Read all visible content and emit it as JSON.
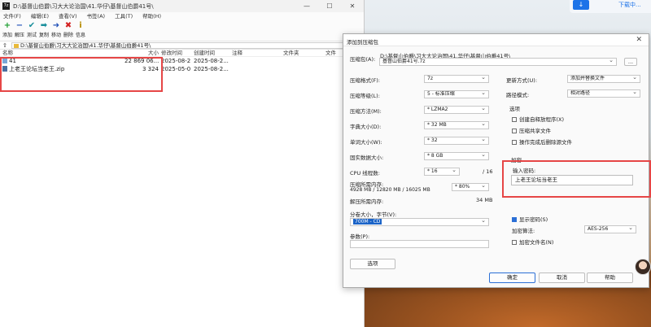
{
  "desktop": {
    "top_card_label": "下载中..."
  },
  "main_window": {
    "title": "D:\\基督山伯爵\\习大大论治国\\41.华仔\\基督山伯爵41号\\",
    "app_icon": "7z",
    "menu": [
      "文件(F)",
      "编辑(E)",
      "查看(V)",
      "书签(A)",
      "工具(T)",
      "帮助(H)"
    ],
    "toolbar": [
      {
        "label": "添加",
        "icon": "+",
        "color": "#1a9c2c"
      },
      {
        "label": "解压",
        "icon": "−",
        "color": "#2453b8"
      },
      {
        "label": "测试",
        "icon": "✔",
        "color": "#1a8f9c"
      },
      {
        "label": "复制",
        "icon": "➡",
        "color": "#1a8f9c"
      },
      {
        "label": "移动",
        "icon": "➜",
        "color": "#2453b8"
      },
      {
        "label": "删除",
        "icon": "✖",
        "color": "#d32020"
      },
      {
        "label": "信息",
        "icon": "i",
        "color": "#b58a00"
      }
    ],
    "address": "D:\\基督山伯爵\\习大大论治国\\41.华仔\\基督山伯爵41号\\",
    "columns": [
      "名称",
      "大小",
      "修改时间",
      "创建时间",
      "注释",
      "文件夹",
      "文件"
    ],
    "files": [
      {
        "name": "41",
        "size": "22 869 06...",
        "modified": "2025-08-2...",
        "created": "2025-08-2...",
        "type": "folder"
      },
      {
        "name": "上老王论坛当老王.zip",
        "size": "3 324",
        "modified": "2025-05-0...",
        "created": "2025-08-2...",
        "type": "zip"
      }
    ]
  },
  "dialog": {
    "title": "添加到压缩包",
    "archive_label": "压缩包(A):",
    "archive_path": "D:\\基督山伯爵\\习大大论治国\\41.华仔\\基督山伯爵41号\\",
    "archive_name": "基督山伯爵41号.7z",
    "browse": "...",
    "format_label": "压缩格式(F):",
    "format": "7z",
    "level_label": "压缩等级(L):",
    "level": "5 - 标准压缩",
    "method_label": "压缩方法(M):",
    "method": "* LZMA2",
    "dict_label": "字典大小(D):",
    "dict": "* 32 MB",
    "word_label": "单词大小(W):",
    "word": "* 32",
    "solid_label": "固实数据大小:",
    "solid": "* 8 GB",
    "cpu_label": "CPU 线程数:",
    "cpu": "* 16",
    "cpu_total": "/ 16",
    "mem_comp_label": "压缩所需内存:",
    "mem_comp_detail": "4928 MB / 12820 MB / 16025 MB",
    "mem_pct": "* 80%",
    "mem_decomp_label": "解压所需内存:",
    "mem_decomp": "34 MB",
    "split_label": "分卷大小，字节(V):",
    "split": "700M - CD",
    "params_label": "参数(P):",
    "options_btn": "选项",
    "update_label": "更新方式(U):",
    "update": "添加并替换文件",
    "path_label": "路径模式:",
    "path_mode": "相对路径",
    "options_title": "选项",
    "opt_sfx": "创建自释放程序(X)",
    "opt_shared": "压缩共享文件",
    "opt_delete": "操作完成后删除源文件",
    "enc_title": "加密",
    "pw_label": "输入密码:",
    "password": "上老王论坛当老王",
    "show_pw": "显示密码(S)",
    "enc_method_label": "加密算法:",
    "enc_method": "AES-256",
    "enc_names": "加密文件名(N)",
    "ok": "确定",
    "cancel": "取消",
    "help": "帮助"
  }
}
